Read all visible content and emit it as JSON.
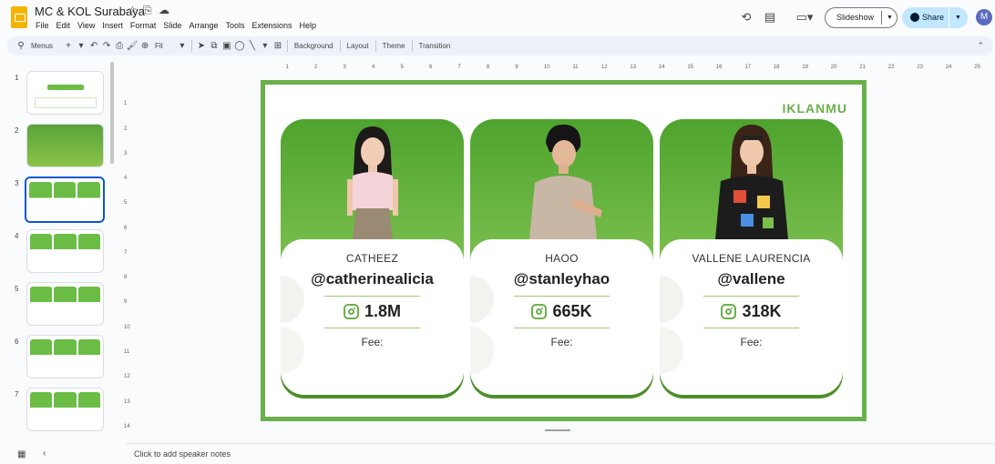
{
  "app": {
    "doc_title": "MC & KOL Surabaya",
    "menu": [
      "File",
      "Edit",
      "View",
      "Insert",
      "Format",
      "Slide",
      "Arrange",
      "Tools",
      "Extensions",
      "Help"
    ],
    "slideshow_label": "Slideshow",
    "share_label": "Share",
    "avatar_initial": "M"
  },
  "toolbar": {
    "menus_label": "Menus",
    "zoom_label": "Fit",
    "background_label": "Background",
    "layout_label": "Layout",
    "theme_label": "Theme",
    "transition_label": "Transition"
  },
  "filmstrip": {
    "slide_numbers": [
      "1",
      "2",
      "3",
      "4",
      "5",
      "6",
      "7"
    ],
    "selected_slide": 3
  },
  "rulers": {
    "horizontal": [
      "1",
      "2",
      "3",
      "4",
      "5",
      "6",
      "7",
      "8",
      "9",
      "10",
      "11",
      "12",
      "13",
      "14",
      "15",
      "16",
      "17",
      "18",
      "19",
      "20",
      "21",
      "22",
      "23",
      "24",
      "25"
    ],
    "vertical": [
      "1",
      "2",
      "3",
      "4",
      "5",
      "6",
      "7",
      "8",
      "9",
      "10",
      "11",
      "12",
      "13",
      "14"
    ]
  },
  "slide": {
    "brand": "IKLANMU",
    "accent_color": "#6ab04c",
    "kols": [
      {
        "name": "CATHEEZ",
        "handle": "@catherinealicia",
        "followers": "1.8M",
        "fee_label": "Fee:"
      },
      {
        "name": "HAOO",
        "handle": "@stanleyhao",
        "followers": "665K",
        "fee_label": "Fee:"
      },
      {
        "name": "VALLENE LAURENCIA",
        "handle": "@vallene",
        "followers": "318K",
        "fee_label": "Fee:"
      }
    ]
  },
  "notes": {
    "placeholder": "Click to add speaker notes"
  }
}
